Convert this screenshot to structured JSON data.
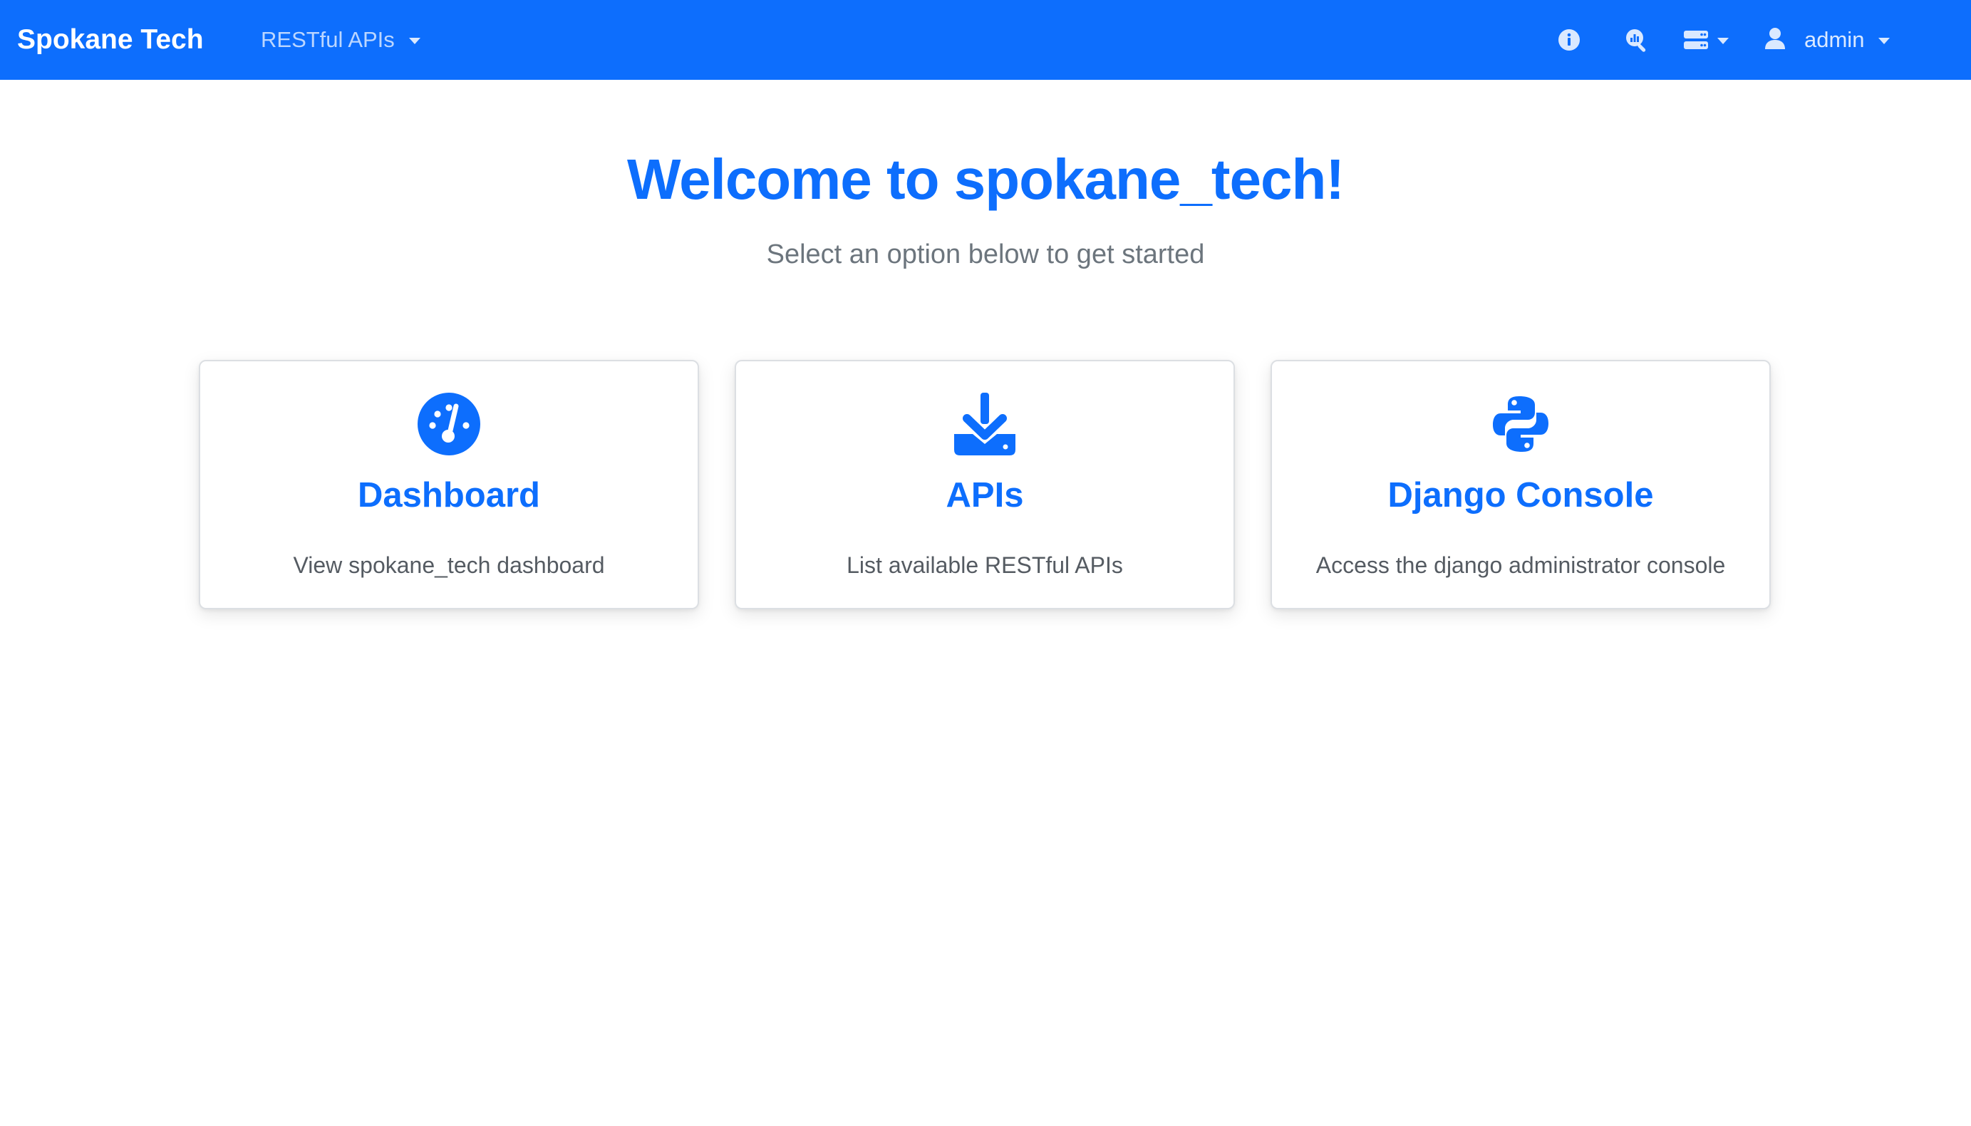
{
  "navbar": {
    "brand": "Spokane Tech",
    "menu_label": "RESTful APIs",
    "icons": [
      "info-icon",
      "search-chart-icon",
      "server-icon"
    ],
    "user_label": "admin"
  },
  "hero": {
    "title": "Welcome to spokane_tech!",
    "subtitle": "Select an option below to get started"
  },
  "cards": [
    {
      "icon": "gauge-icon",
      "title": "Dashboard",
      "description": "View spokane_tech dashboard"
    },
    {
      "icon": "download-icon",
      "title": "APIs",
      "description": "List available RESTful APIs"
    },
    {
      "icon": "python-icon",
      "title": "Django Console",
      "description": "Access the django administrator console"
    }
  ],
  "colors": {
    "primary": "#0d6efd",
    "muted": "#6c757d",
    "background": "#ffffff"
  }
}
